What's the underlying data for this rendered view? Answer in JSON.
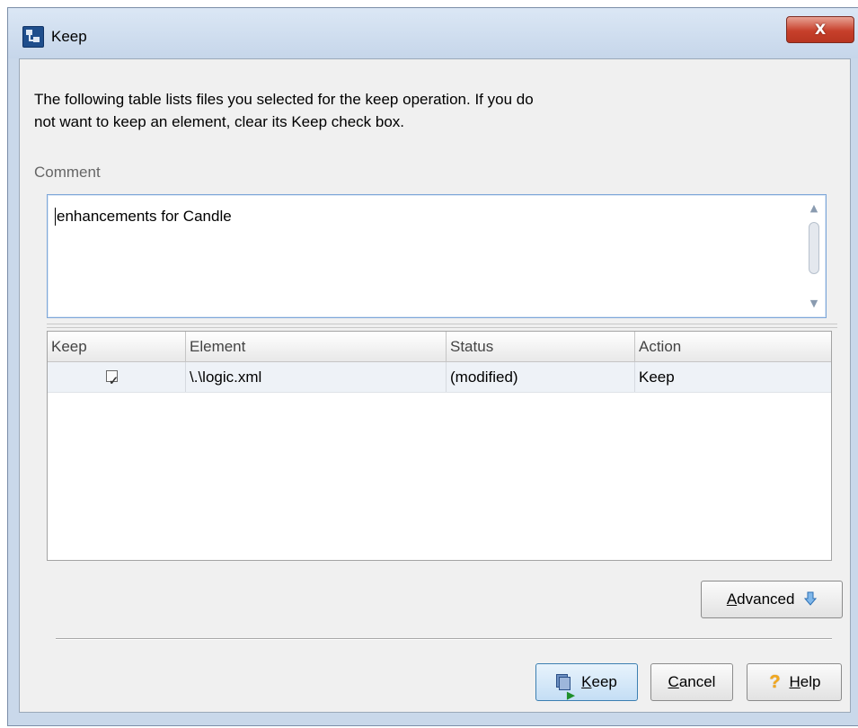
{
  "window": {
    "title": "Keep",
    "close_label": "X"
  },
  "dialog": {
    "intro_line1": "The following table lists files you selected for the keep operation. If you do",
    "intro_line2": "not want to keep an element, clear its Keep check box.",
    "comment_label": "Comment",
    "comment_value": "enhancements for Candle"
  },
  "table": {
    "columns": [
      "Keep",
      "Element",
      "Status",
      "Action"
    ],
    "rows": [
      {
        "keep_checked": true,
        "element": "\\.\\logic.xml",
        "status": "(modified)",
        "action": "Keep"
      }
    ]
  },
  "buttons": {
    "advanced_pre": "",
    "advanced_mnemonic": "A",
    "advanced_post": "dvanced",
    "keep_mnemonic": "K",
    "keep_post": "eep",
    "cancel_mnemonic": "C",
    "cancel_post": "ancel",
    "help_mnemonic": "H",
    "help_post": "elp"
  },
  "icons": {
    "app": "app-icon",
    "advanced": "arrow-down-icon",
    "keep": "keep-icon",
    "help": "help-icon"
  }
}
